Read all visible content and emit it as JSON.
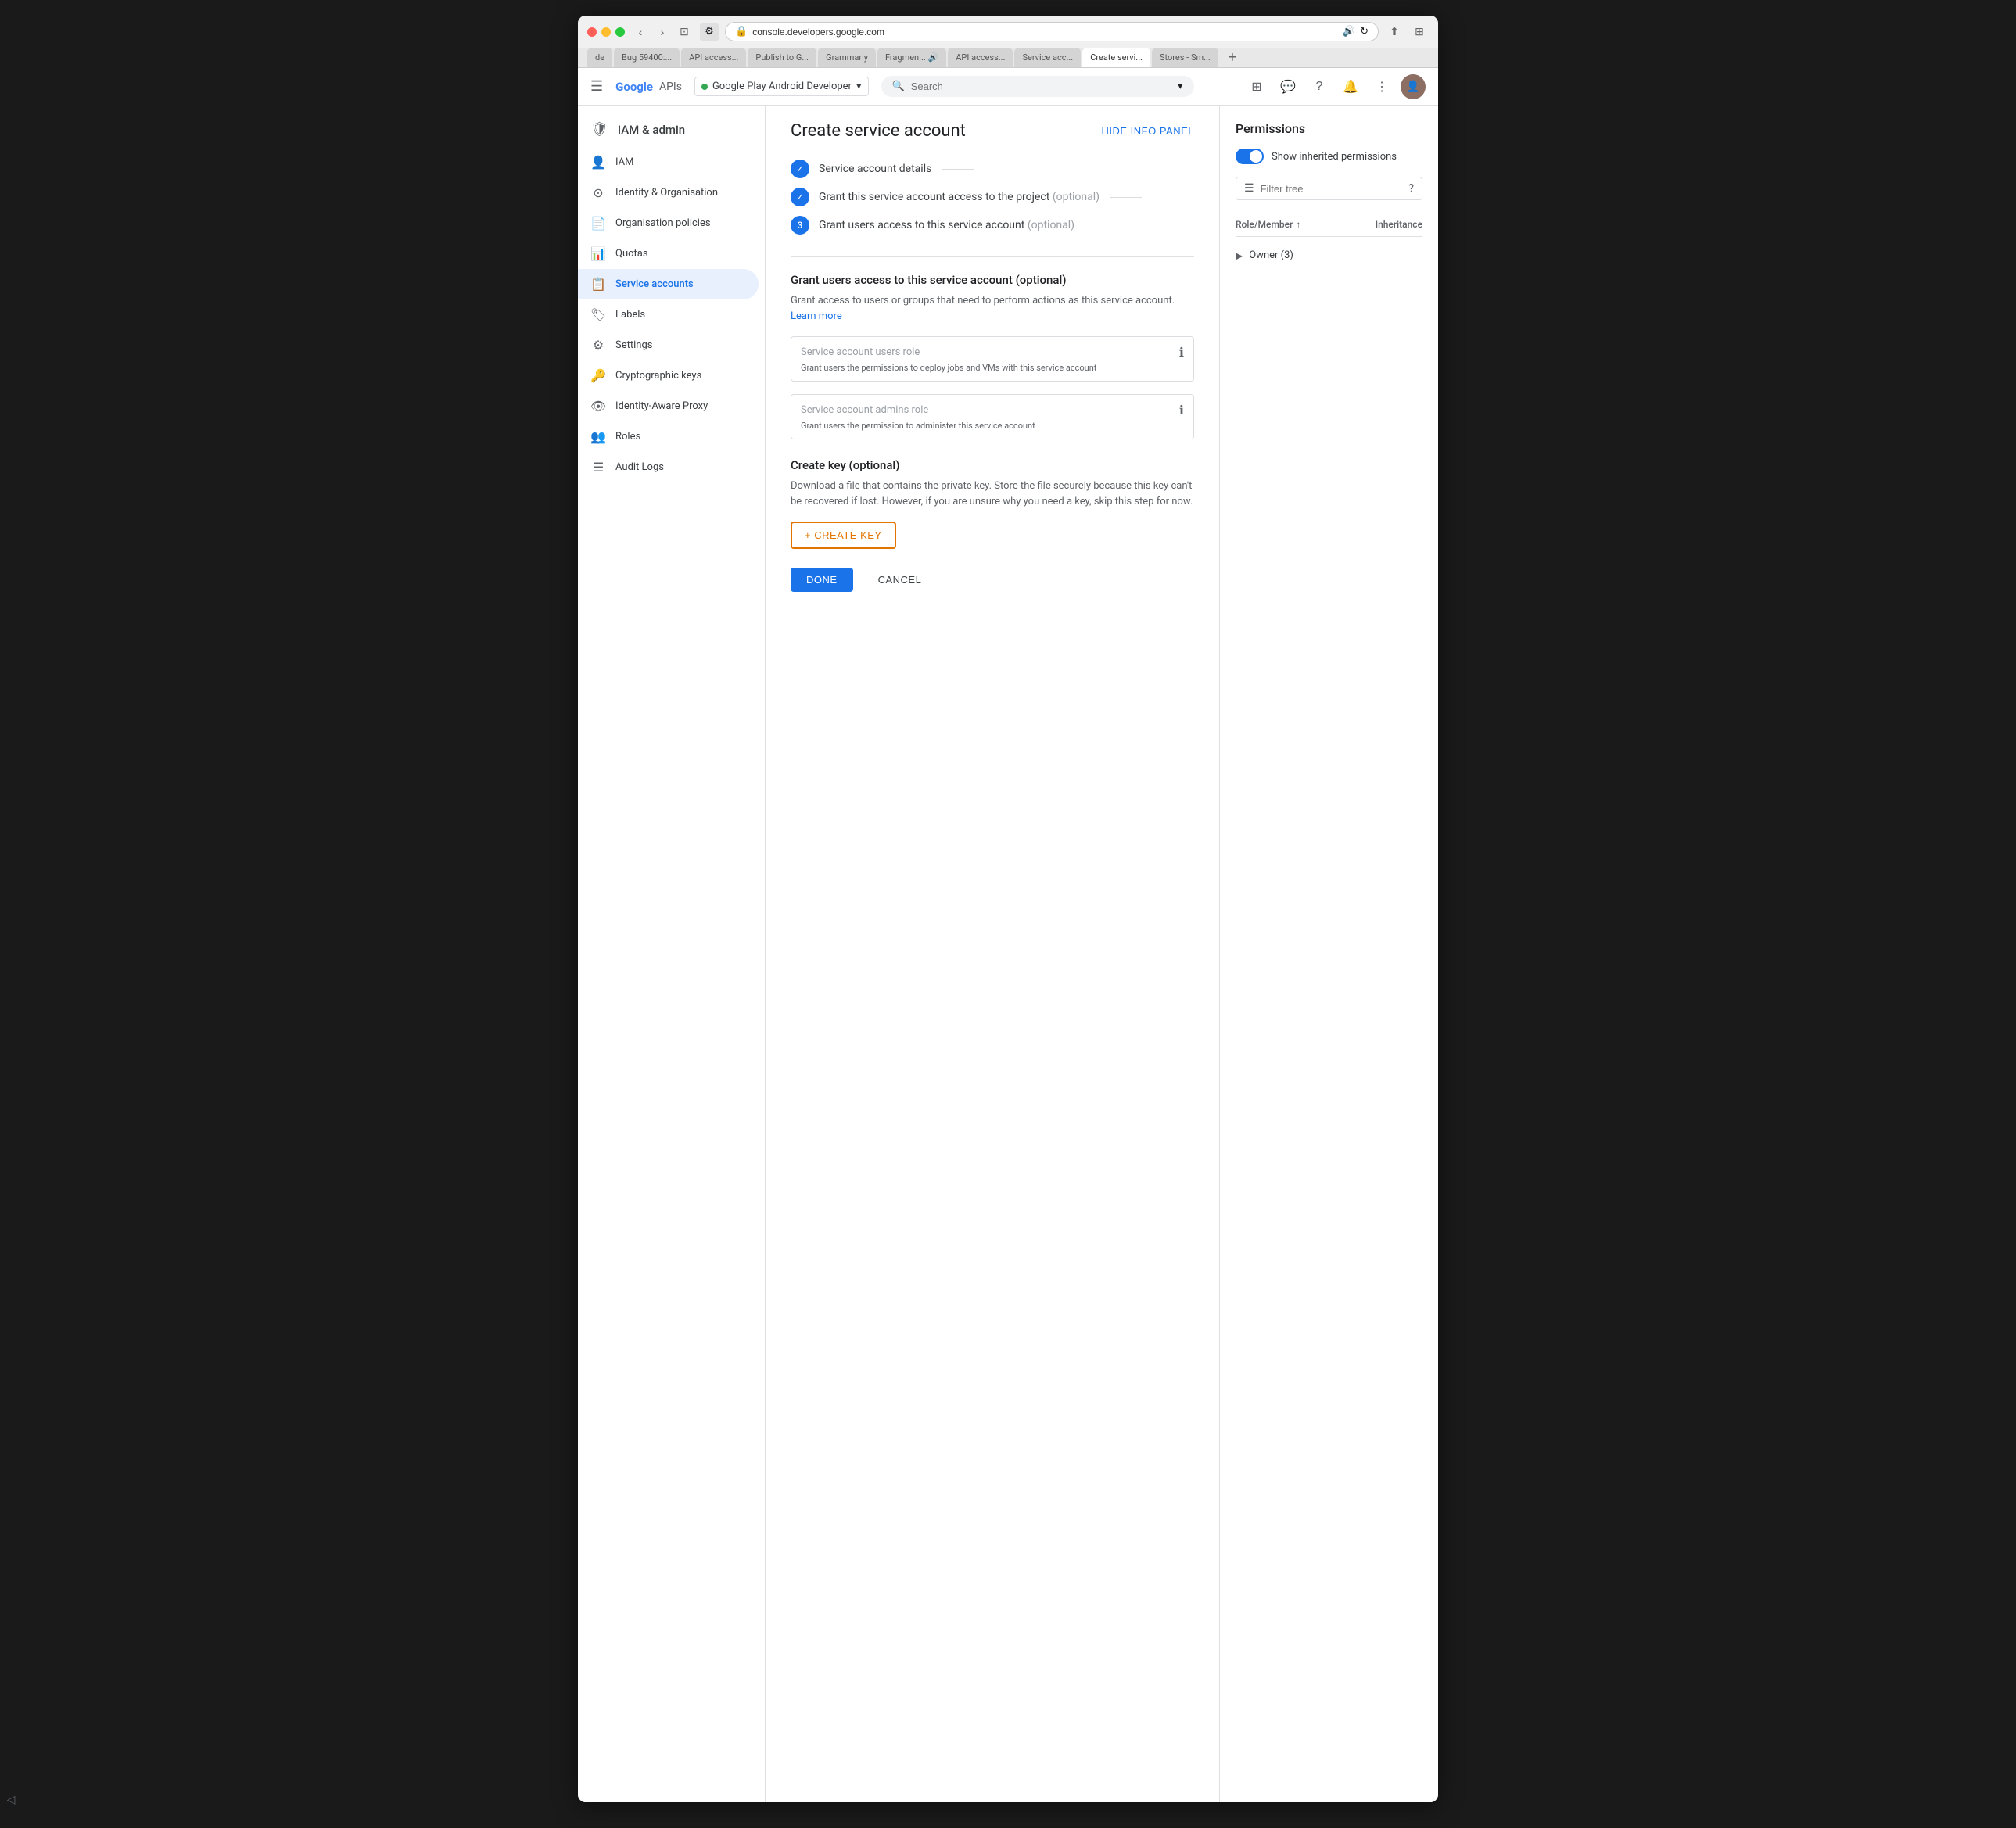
{
  "browser": {
    "url": "console.developers.google.com",
    "tabs": [
      {
        "label": "de",
        "active": false
      },
      {
        "label": "Bug 59400:...",
        "active": false
      },
      {
        "label": "API access...",
        "active": false
      },
      {
        "label": "Publish to G...",
        "active": false
      },
      {
        "label": "Grammarly",
        "active": false
      },
      {
        "label": "Fragmen...",
        "active": false
      },
      {
        "label": "API access...",
        "active": false
      },
      {
        "label": "Service acc...",
        "active": false
      },
      {
        "label": "Create servi...",
        "active": true
      },
      {
        "label": "Stores - Sm...",
        "active": false
      }
    ]
  },
  "topnav": {
    "project_name": "Google Play Android Developer",
    "search_placeholder": "Search",
    "apps_icon": "⊞",
    "help_icon": "?",
    "notifications_icon": "🔔",
    "more_icon": "⋮"
  },
  "sidebar": {
    "title": "IAM & admin",
    "items": [
      {
        "label": "IAM",
        "icon": "person_add",
        "active": false
      },
      {
        "label": "Identity & Organisation",
        "icon": "account_circle",
        "active": false
      },
      {
        "label": "Organisation policies",
        "icon": "description",
        "active": false
      },
      {
        "label": "Quotas",
        "icon": "bar_chart",
        "active": false
      },
      {
        "label": "Service accounts",
        "icon": "person_pin",
        "active": true
      },
      {
        "label": "Labels",
        "icon": "label",
        "active": false
      },
      {
        "label": "Settings",
        "icon": "settings",
        "active": false
      },
      {
        "label": "Cryptographic keys",
        "icon": "vpn_key",
        "active": false
      },
      {
        "label": "Identity-Aware Proxy",
        "icon": "visibility",
        "active": false
      },
      {
        "label": "Roles",
        "icon": "group",
        "active": false
      },
      {
        "label": "Audit Logs",
        "icon": "list",
        "active": false
      }
    ]
  },
  "page": {
    "title": "Create service account",
    "hide_info_panel_label": "HIDE INFO PANEL",
    "steps": [
      {
        "number": "✓",
        "label": "Service account details",
        "completed": true,
        "separator": true
      },
      {
        "number": "✓",
        "label": "Grant this service account access to the project",
        "completed": true,
        "optional": "(optional)",
        "separator": true
      },
      {
        "number": "3",
        "label": "Grant users access to this service account",
        "optional": "(optional)",
        "current": true
      }
    ],
    "grant_section": {
      "title": "Grant users access to this service account (optional)",
      "description": "Grant access to users or groups that need to perform actions as this service account.",
      "learn_more": "Learn more",
      "users_role_field": {
        "label": "Service account users role",
        "hint": "Grant users the permissions to deploy jobs and VMs with this service account"
      },
      "admins_role_field": {
        "label": "Service account admins role",
        "hint": "Grant users the permission to administer this service account"
      }
    },
    "create_key_section": {
      "title": "Create key (optional)",
      "description": "Download a file that contains the private key. Store the file securely because this key can't be recovered if lost. However, if you are unsure why you need a key, skip this step for now.",
      "button_label": "+ CREATE KEY"
    },
    "actions": {
      "done_label": "DONE",
      "cancel_label": "CANCEL"
    }
  },
  "info_panel": {
    "title": "Permissions",
    "toggle_label": "Show inherited permissions",
    "toggle_on": true,
    "filter_placeholder": "Filter tree",
    "table_headers": {
      "role_member": "Role/Member",
      "inheritance": "Inheritance"
    },
    "rows": [
      {
        "label": "Owner (3)",
        "expanded": false
      }
    ]
  }
}
